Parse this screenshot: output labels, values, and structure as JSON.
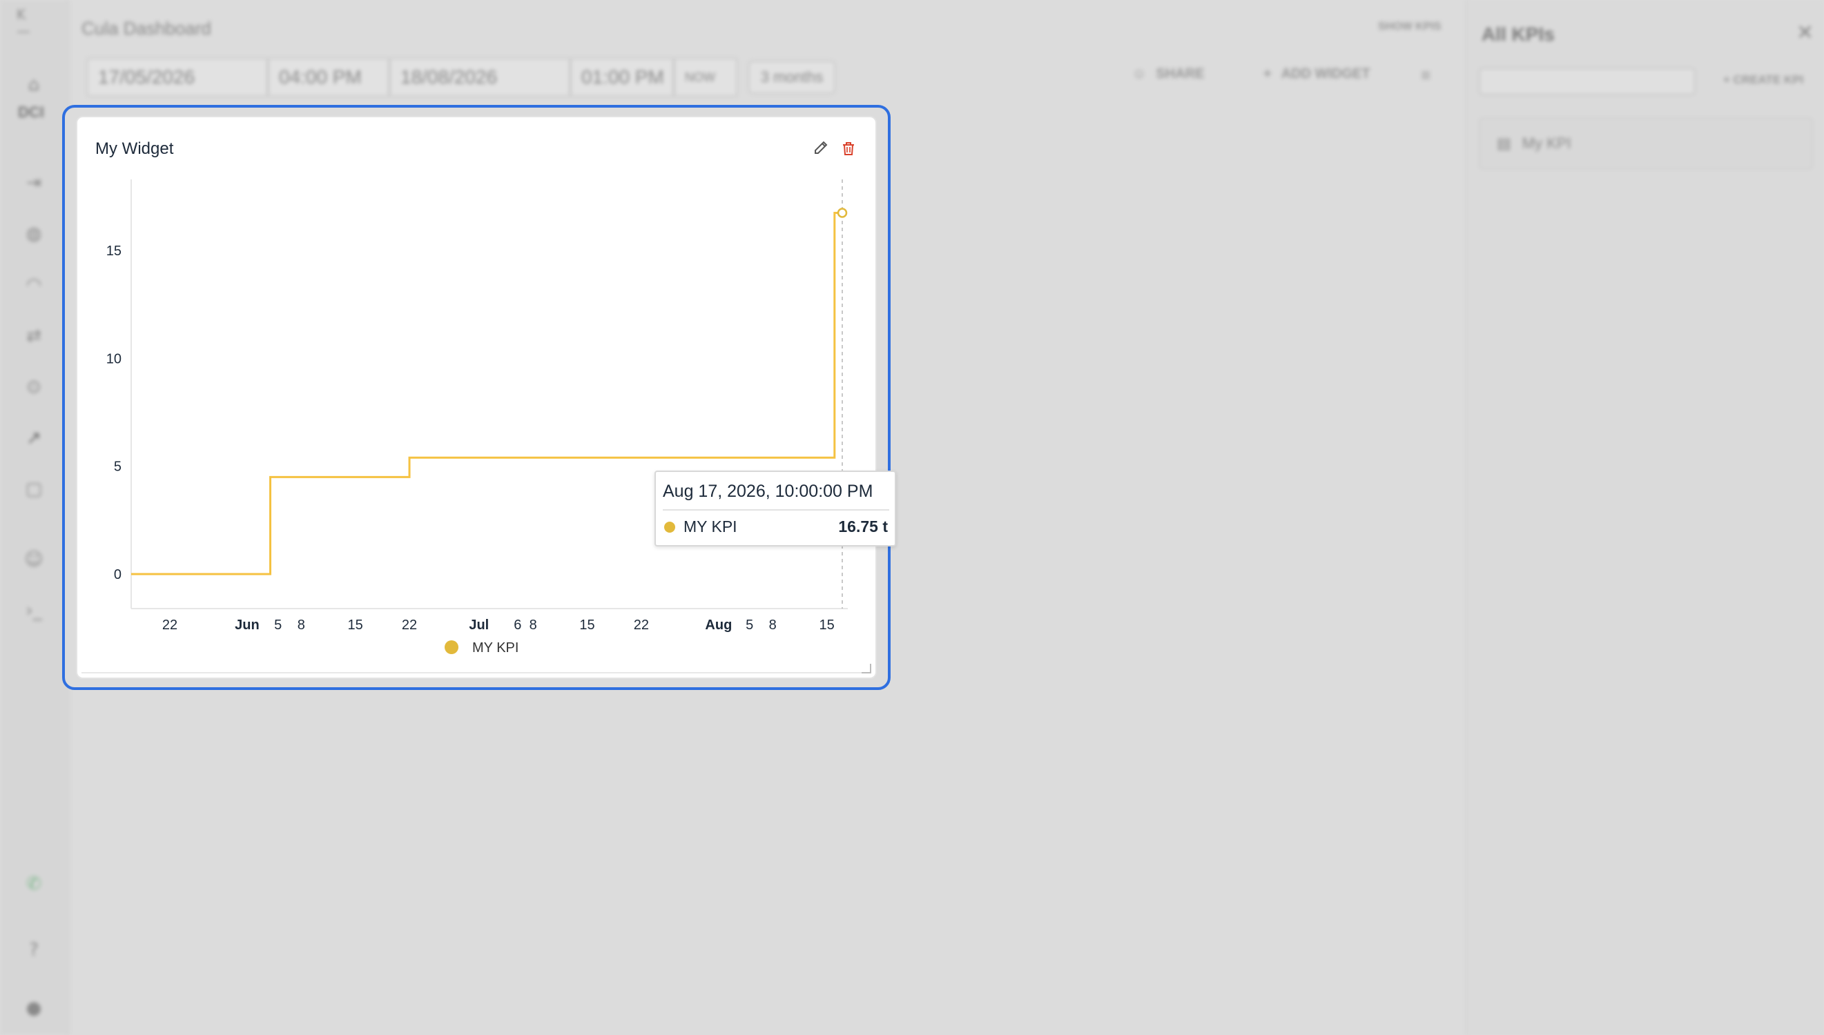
{
  "app": {
    "sidebar_label": "DCI",
    "dashboard_title": "Cula Dashboard",
    "show_kpis": "SHOW KPIS"
  },
  "toolbar": {
    "start_date": "17/05/2026",
    "start_time": "04:00 PM",
    "end_date": "18/08/2026",
    "end_time": "01:00 PM",
    "now_label": "NOW",
    "range_label": "3 months",
    "share_label": "SHARE",
    "add_widget_label": "ADD WIDGET"
  },
  "kpi_panel": {
    "title": "All KPIs",
    "search_placeholder": "",
    "create_label": "+ CREATE KPI",
    "items": [
      {
        "label": "My KPI"
      }
    ]
  },
  "widget": {
    "title": "My Widget"
  },
  "tooltip": {
    "date": "Aug 17, 2026, 10:00:00 PM",
    "series": "MY KPI",
    "value": "16.75 t"
  },
  "colors": {
    "series": "#f5c242",
    "tooltip_dot": "#e2b93b",
    "focus": "#2f6fe0",
    "delete": "#d9412b"
  },
  "chart_data": {
    "type": "line",
    "step": true,
    "x_start": "2026-05-17",
    "x_end": "2026-08-17",
    "ylim": [
      -1.6,
      18.3
    ],
    "y_ticks": [
      0,
      5,
      10,
      15
    ],
    "x_ticks": [
      {
        "label": "22",
        "date": "2026-05-22",
        "bold": false
      },
      {
        "label": "Jun",
        "date": "2026-06-01",
        "bold": true
      },
      {
        "label": "5",
        "date": "2026-06-05",
        "bold": false
      },
      {
        "label": "8",
        "date": "2026-06-08",
        "bold": false
      },
      {
        "label": "15",
        "date": "2026-06-15",
        "bold": false
      },
      {
        "label": "22",
        "date": "2026-06-22",
        "bold": false
      },
      {
        "label": "Jul",
        "date": "2026-07-01",
        "bold": true
      },
      {
        "label": "6",
        "date": "2026-07-06",
        "bold": false
      },
      {
        "label": "8",
        "date": "2026-07-08",
        "bold": false
      },
      {
        "label": "15",
        "date": "2026-07-15",
        "bold": false
      },
      {
        "label": "22",
        "date": "2026-07-22",
        "bold": false
      },
      {
        "label": "Aug",
        "date": "2026-08-01",
        "bold": true
      },
      {
        "label": "5",
        "date": "2026-08-05",
        "bold": false
      },
      {
        "label": "8",
        "date": "2026-08-08",
        "bold": false
      },
      {
        "label": "15",
        "date": "2026-08-15",
        "bold": false
      }
    ],
    "series": [
      {
        "name": "MY KPI",
        "unit": "t",
        "points": [
          {
            "x": "2026-05-17",
            "y": 0
          },
          {
            "x": "2026-06-04",
            "y": 4.5
          },
          {
            "x": "2026-06-22",
            "y": 5.4
          },
          {
            "x": "2026-08-16",
            "y": 16.75
          },
          {
            "x": "2026-08-17",
            "y": 16.75
          }
        ]
      }
    ],
    "hover_x": "2026-08-17",
    "legend": "bottom-center"
  }
}
